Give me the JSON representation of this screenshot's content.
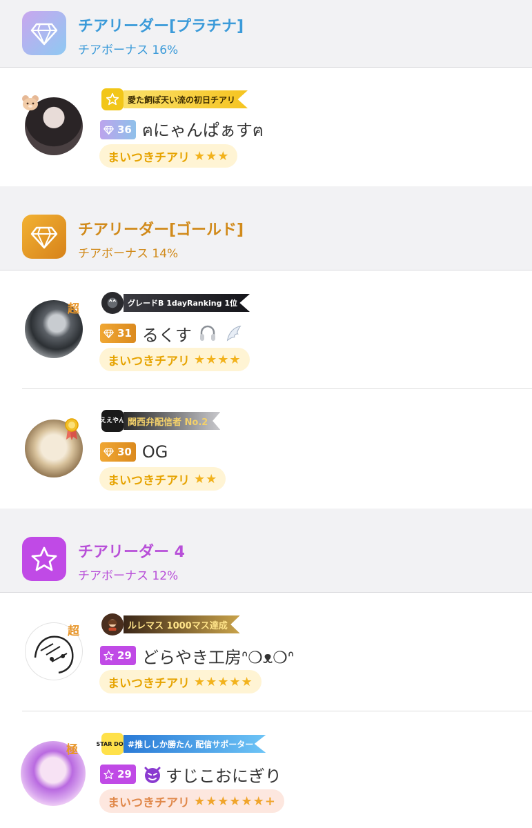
{
  "tiers": [
    {
      "title": "チアリーダー[プラチナ]",
      "bonus": "チアボーナス 16%",
      "color": "#3a9ad9"
    },
    {
      "title": "チアリーダー[ゴールド]",
      "bonus": "チアボーナス 14%",
      "color": "#d18a1a"
    },
    {
      "title": "チアリーダー 4",
      "bonus": "チアボーナス 12%",
      "color": "#b84fd8"
    }
  ],
  "users": [
    {
      "banner": "愛た飼ぽ天い流の初日チアリ",
      "level": "36",
      "name": "ฅにゃんぱぁすฅ",
      "maitsuki": "まいつきチアリ",
      "stars": "★★★",
      "avatar_mark": "bear-badge-icon"
    },
    {
      "banner": "グレードB 1dayRanking 1位",
      "level": "31",
      "name": "るくす",
      "maitsuki": "まいつきチアリ",
      "stars": "★★★★",
      "avatar_mark": "超"
    },
    {
      "banner": "関西弁配信者 No.2",
      "banner_icon_text": "ええやん",
      "level": "30",
      "name": "OG",
      "maitsuki": "まいつきチアリ",
      "stars": "★★",
      "avatar_mark": "medal-icon"
    },
    {
      "banner": "ルレマス 1000マス達成",
      "level": "29",
      "name": "どらやき工房ᐢ❍ᴥ❍ᐢ",
      "maitsuki": "まいつきチアリ",
      "stars": "★★★★★",
      "avatar_mark": "超"
    },
    {
      "banner": "#推ししか勝たん 配信サポーター",
      "banner_icon_text": "STAR DOM",
      "level": "29",
      "name": "すじこおにぎり",
      "maitsuki": "まいつきチアリ",
      "stars": "★★★★★★+",
      "avatar_mark": "極"
    }
  ]
}
